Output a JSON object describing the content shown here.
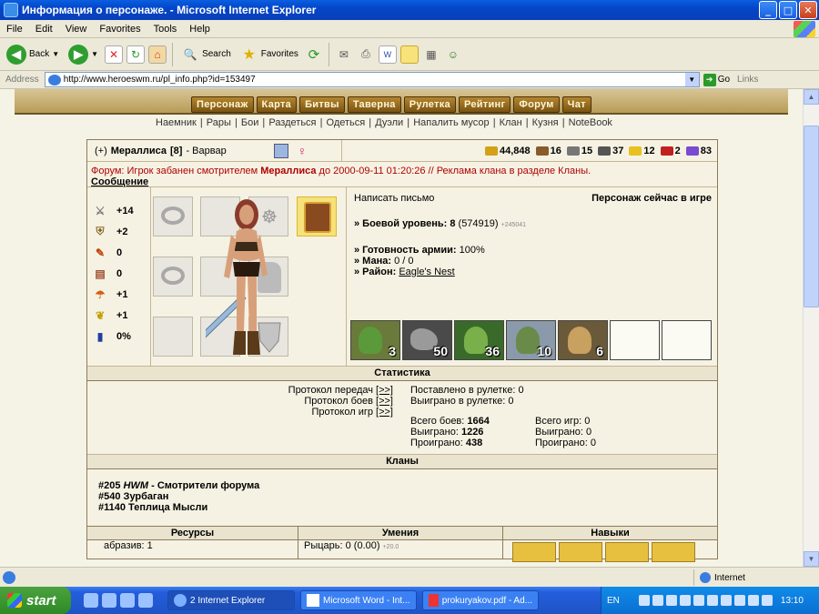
{
  "window": {
    "title": "Информация о персонаже. - Microsoft Internet Explorer"
  },
  "menu": [
    "File",
    "Edit",
    "View",
    "Favorites",
    "Tools",
    "Help"
  ],
  "toolbar": {
    "back": "Back",
    "search": "Search",
    "favorites": "Favorites"
  },
  "address": {
    "label": "Address",
    "url": "http://www.heroeswm.ru/pl_info.php?id=153497",
    "go": "Go",
    "links": "Links"
  },
  "site": {
    "nav": [
      "Персонаж",
      "Карта",
      "Битвы",
      "Таверна",
      "Рулетка",
      "Рейтинг",
      "Форум",
      "Чат"
    ],
    "subnav": [
      "Наемник",
      "Рары",
      "Бои",
      "Раздеться",
      "Одеться",
      "Дуэли",
      "Напалить мусор",
      "Клан",
      "Кузня",
      "NoteBook"
    ]
  },
  "player": {
    "name_prefix": "(+)",
    "name": "Мераллиса",
    "level": "[8]",
    "class": "- Варвар",
    "resources": [
      {
        "icon": "gold-icon",
        "value": "44,848",
        "color": "#d4a017"
      },
      {
        "icon": "wood-icon",
        "value": "16",
        "color": "#8b5a2b"
      },
      {
        "icon": "ore-icon",
        "value": "15",
        "color": "#777777"
      },
      {
        "icon": "mercury-icon",
        "value": "37",
        "color": "#555555"
      },
      {
        "icon": "sulfur-icon",
        "value": "12",
        "color": "#e8c020"
      },
      {
        "icon": "crystal-icon",
        "value": "2",
        "color": "#c02020"
      },
      {
        "icon": "gem-icon",
        "value": "83",
        "color": "#7a4ad0"
      }
    ]
  },
  "forum_notice": {
    "text1": "Форум: Игрок забанен смотрителем ",
    "moderator": "Мераллиса",
    "text2": " до 2000-09-11 01:20:26 // Реклама клана в разделе Кланы.",
    "link": "Сообщение"
  },
  "stats": [
    {
      "icon": "attack-icon",
      "value": "+14"
    },
    {
      "icon": "defense-icon",
      "value": "+2"
    },
    {
      "icon": "spellpower-icon",
      "value": "0"
    },
    {
      "icon": "knowledge-icon",
      "value": "0"
    },
    {
      "icon": "luck-icon",
      "value": "+1"
    },
    {
      "icon": "morale-icon",
      "value": "+1"
    },
    {
      "icon": "mana-icon",
      "value": "0%"
    }
  ],
  "info": {
    "write_letter": "Написать письмо",
    "online": "Персонаж сейчас в игре",
    "combat_level_label": "» Боевой уровень: ",
    "combat_level": "8",
    "exp": " (574919)",
    "exp_small": "+245041",
    "army_ready_label": "» Готовность армии: ",
    "army_ready": "100%",
    "mana_label": "» Мана: ",
    "mana": "0 / 0",
    "district_label": "» Район: ",
    "district": "Eagle's Nest"
  },
  "army": [
    {
      "count": "3"
    },
    {
      "count": "50"
    },
    {
      "count": "36"
    },
    {
      "count": "10"
    },
    {
      "count": "6"
    },
    {
      "count": ""
    },
    {
      "count": ""
    }
  ],
  "statistics": {
    "header": "Статистика",
    "protocols": [
      "Протокол передач",
      "Протокол боев",
      "Протокол игр"
    ],
    "protocol_link": "[>>]",
    "roulette_bet": "Поставлено в рулетке: 0",
    "roulette_won": "Выиграно в рулетке: 0",
    "battles_total_label": "Всего боев: ",
    "battles_total": "1664",
    "battles_won_label": "Выиграно: ",
    "battles_won": "1226",
    "battles_lost_label": "Проиграно: ",
    "battles_lost": "438",
    "games_total": "Всего игр: 0",
    "games_won": "Выиграно: 0",
    "games_lost": "Проиграно: 0"
  },
  "clans": {
    "header": "Кланы",
    "list": [
      {
        "id": "#205",
        "name": "HWM",
        "suffix": " - Смотрители форума"
      },
      {
        "id": "#540",
        "name": "Зурбаган",
        "suffix": ""
      },
      {
        "id": "#1140",
        "name": "Теплица Мысли",
        "suffix": ""
      }
    ]
  },
  "bottom": {
    "resources_header": "Ресурсы",
    "skills_header": "Умения",
    "talents_header": "Навыки",
    "resource_row": "абразив: 1",
    "skill_row": "Рыцарь: 0 (0.00)",
    "skill_small": "+20.0"
  },
  "status": {
    "zone": "Internet"
  },
  "taskbar": {
    "start": "start",
    "tasks": [
      "2 Internet Explorer",
      "Microsoft Word - Int...",
      "prokuryakov.pdf - Ad..."
    ],
    "lang": "EN",
    "time": "13:10"
  }
}
